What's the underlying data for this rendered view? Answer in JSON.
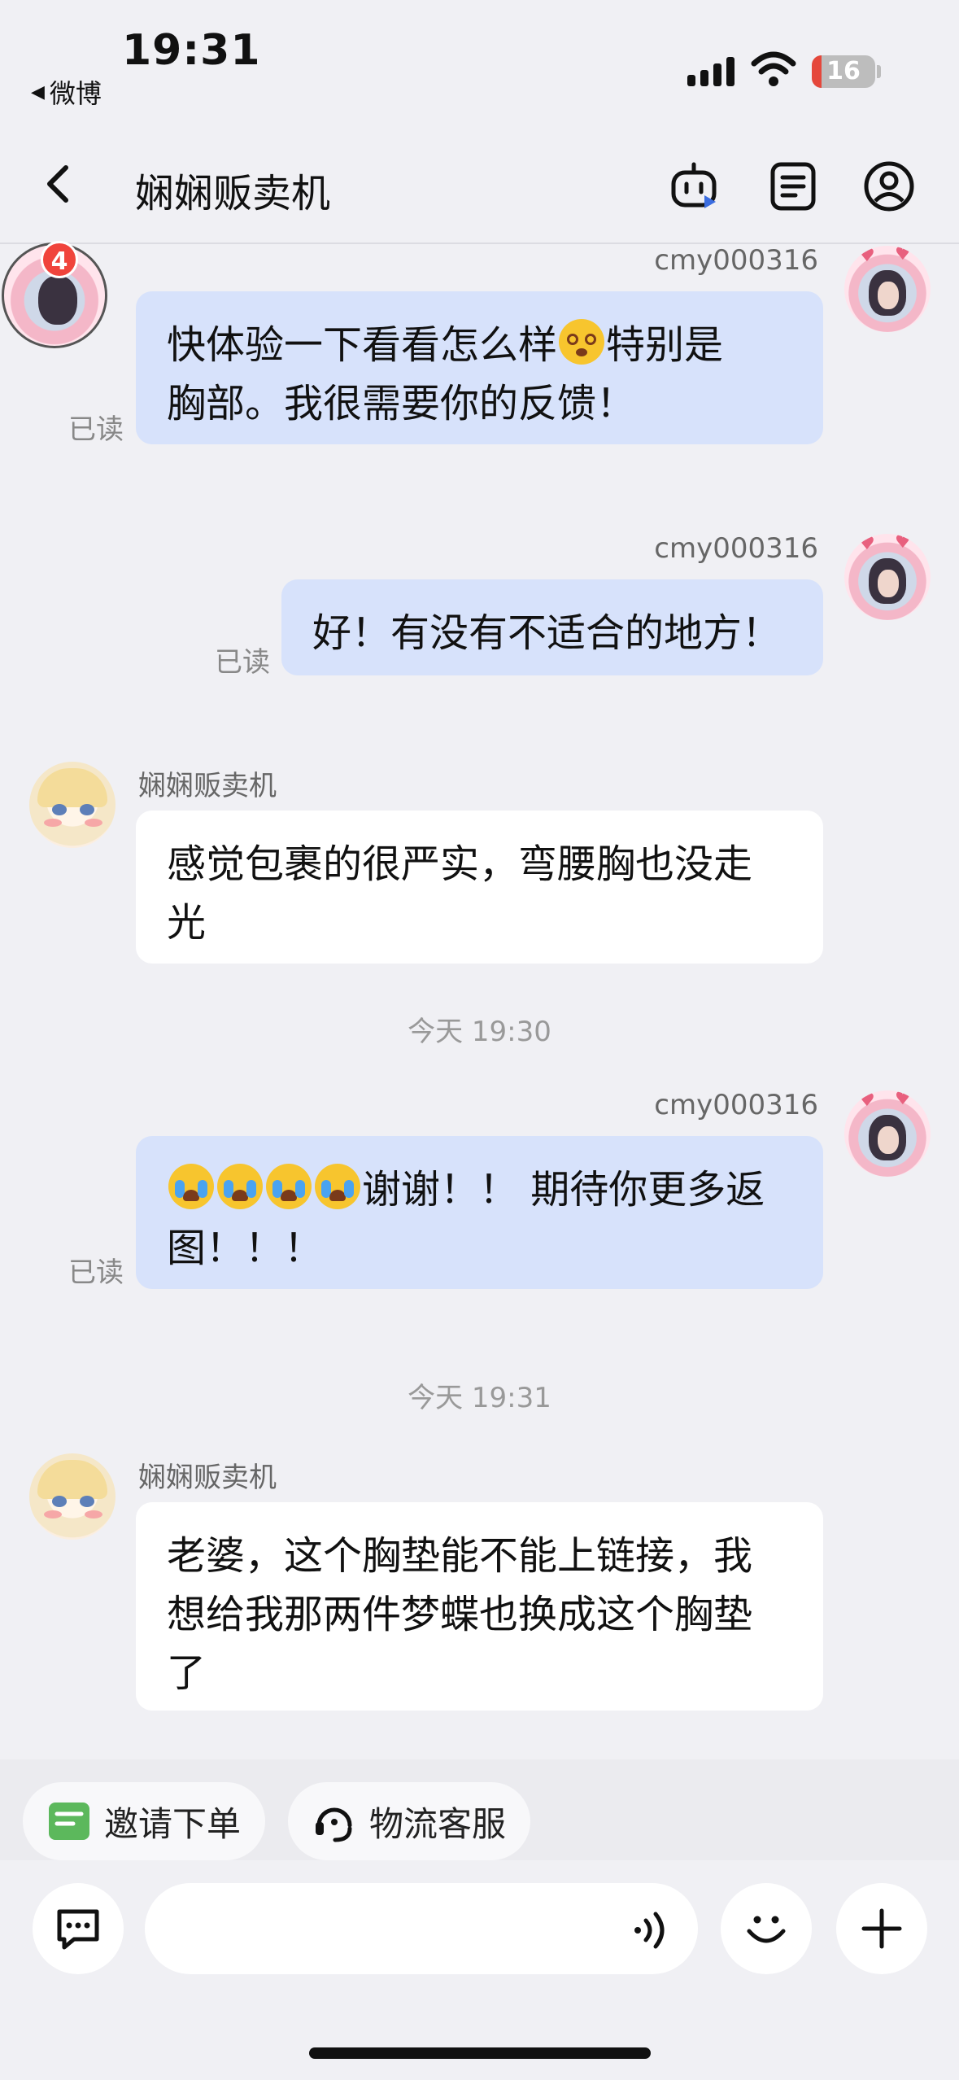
{
  "status_bar": {
    "time": "19:31",
    "back_app": "微博",
    "battery_level": "16",
    "battery_fraction": 0.16,
    "battery_color": "#e5473b"
  },
  "header": {
    "title": "娴娴贩卖机",
    "back_icon": "chevron-left-icon",
    "robot_icon": "robot-icon",
    "notes_icon": "notes-icon",
    "profile_icon": "profile-icon"
  },
  "peer": {
    "unread_badge": "4"
  },
  "messages": [
    {
      "sender": "cmy000316",
      "side": "self",
      "line1": "快体验一下看看怎么样",
      "line1_after": "特别是",
      "line2": "胸部。我很需要你的反馈！",
      "status": "已读"
    },
    {
      "sender": "cmy000316",
      "side": "self",
      "text": "好！有没有不适合的地方！",
      "status": "已读"
    },
    {
      "sender": "娴娴贩卖机",
      "side": "other",
      "line1": "感觉包裹的很严实，弯腰胸也没走",
      "line2": "光"
    },
    {
      "timestamp": "今天 19:30"
    },
    {
      "sender": "cmy000316",
      "side": "self",
      "line1_after": "谢谢！！ 期待你更多返",
      "line2": "图！！！",
      "status": "已读"
    },
    {
      "timestamp": "今天 19:31"
    },
    {
      "sender": "娴娴贩卖机",
      "side": "other",
      "line1": "老婆，这个胸垫能不能上链接，我",
      "line2": "想给我那两件梦蝶也换成这个胸垫",
      "line3": "了"
    }
  ],
  "quick_actions": [
    {
      "label": "邀请下单",
      "icon": "order-invite-icon",
      "color": "#5cb85c"
    },
    {
      "label": "物流客服",
      "icon": "headset-icon"
    }
  ],
  "input": {
    "placeholder": ""
  },
  "colors": {
    "self_bubble": "#d7e2fb",
    "other_bubble": "#ffffff",
    "background": "#f0f0f4"
  }
}
